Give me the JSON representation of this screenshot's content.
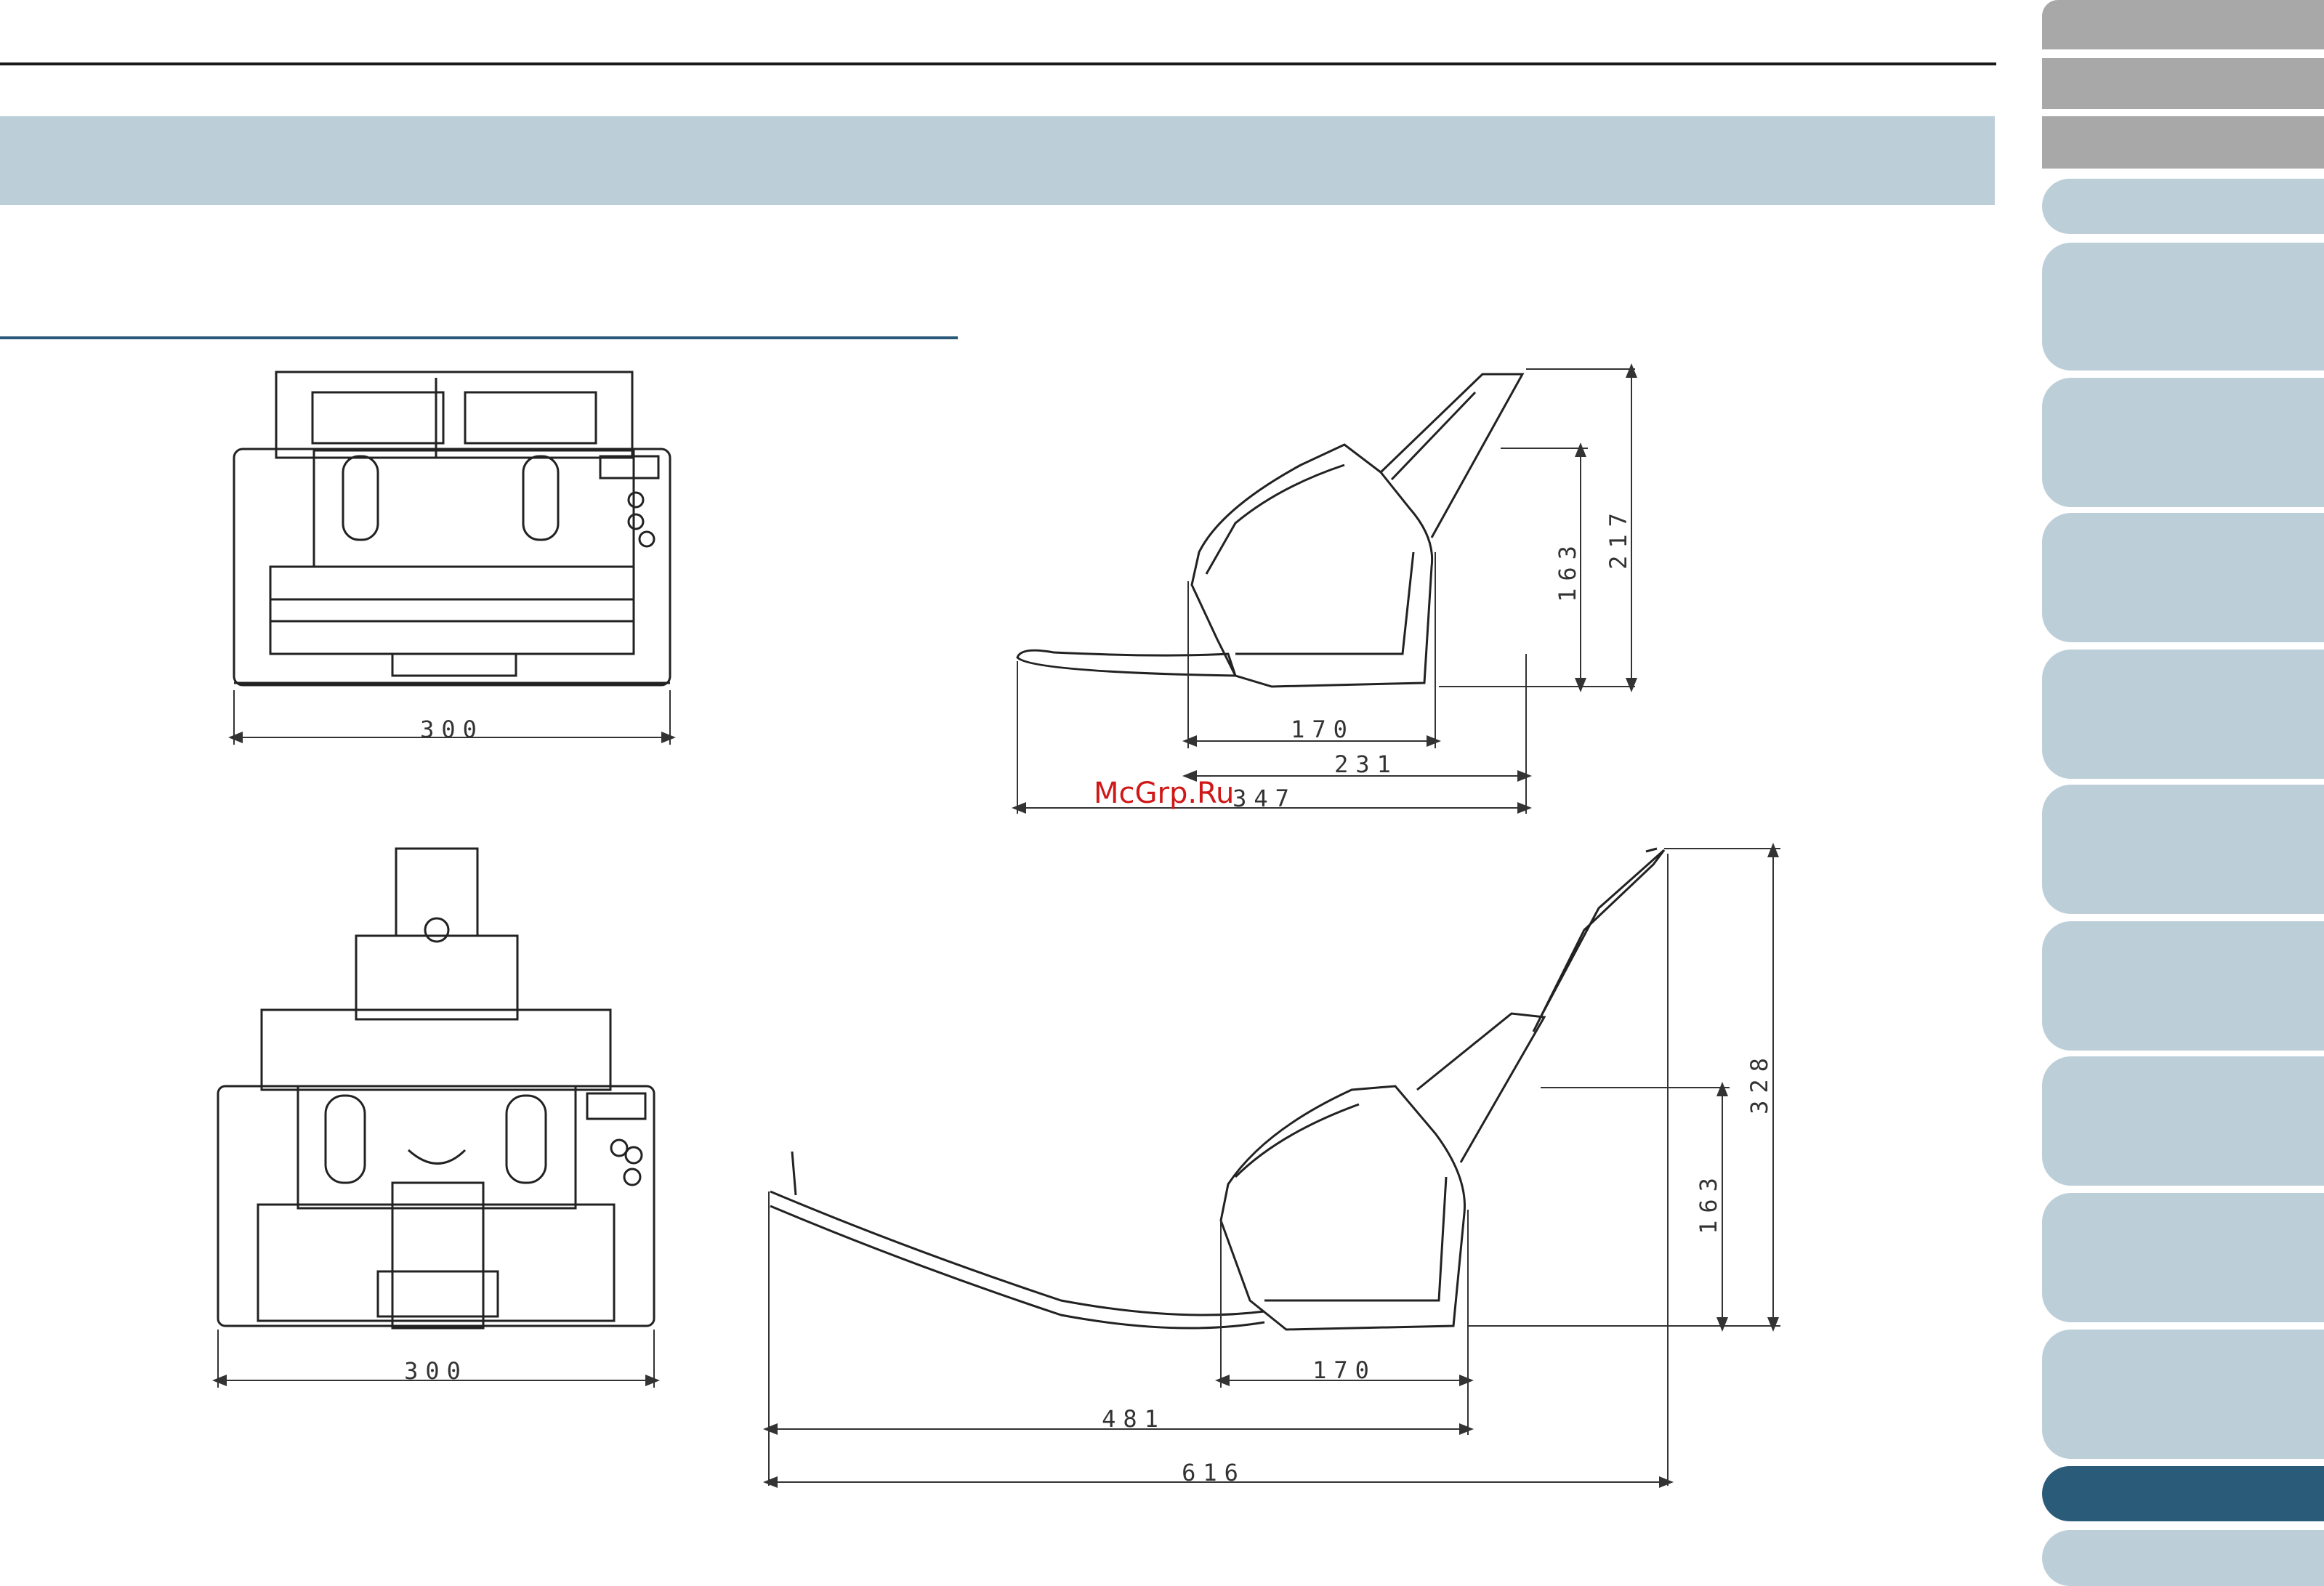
{
  "watermark": "McGrp.Ru",
  "front_view_top": {
    "width_label": "300"
  },
  "side_view_top": {
    "depth_1": "170",
    "depth_2": "231",
    "depth_3": "347",
    "height_1": "163",
    "height_2": "217"
  },
  "front_view_bottom": {
    "width_label": "300"
  },
  "side_view_bottom": {
    "depth_1": "170",
    "depth_2": "481",
    "depth_3": "616",
    "height_1": "163",
    "height_2": "328"
  },
  "colors": {
    "band": "#bccfd9",
    "rule": "#2a5878",
    "tab_gray": "#a8a8a8",
    "tab_active": "#2a5c7a",
    "watermark": "#d01818"
  },
  "tabs": [
    {
      "state": "gray"
    },
    {
      "state": "gray"
    },
    {
      "state": "gray"
    },
    {
      "state": "normal"
    },
    {
      "state": "normal"
    },
    {
      "state": "normal"
    },
    {
      "state": "normal"
    },
    {
      "state": "normal"
    },
    {
      "state": "normal"
    },
    {
      "state": "normal"
    },
    {
      "state": "normal"
    },
    {
      "state": "normal"
    },
    {
      "state": "normal"
    },
    {
      "state": "active"
    },
    {
      "state": "normal"
    }
  ]
}
